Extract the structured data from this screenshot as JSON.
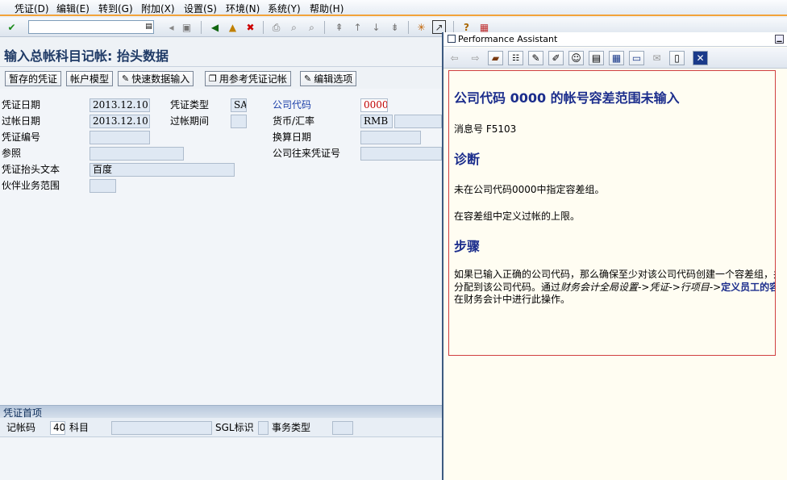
{
  "menu": {
    "items": [
      "凭证(D)",
      "编辑(E)",
      "转到(G)",
      "附加(X)",
      "设置(S)",
      "环境(N)",
      "系统(Y)",
      "帮助(H)"
    ]
  },
  "toolbar": {
    "command_value": "",
    "icons": [
      "ok-check-icon",
      "save-icon",
      "back-icon",
      "exit-icon",
      "cancel-icon",
      "print-icon",
      "find-icon",
      "find-next-icon",
      "first-page-icon",
      "prev-page-icon",
      "next-page-icon",
      "last-page-icon",
      "new-session-icon",
      "shortcut-icon",
      "help-icon",
      "layout-icon"
    ]
  },
  "page": {
    "title": "输入总帐科目记帐: 抬头数据"
  },
  "app_toolbar": {
    "buttons": [
      "暂存的凭证",
      "帐户模型",
      "快速数据输入",
      "用参考凭证记帐",
      "编辑选项"
    ]
  },
  "form": {
    "doc_date_label": "凭证日期",
    "doc_date_value": "2013.12.10",
    "doc_type_label": "凭证类型",
    "doc_type_value": "SA",
    "company_code_label": "公司代码",
    "company_code_value": "0000",
    "posting_date_label": "过帐日期",
    "posting_date_value": "2013.12.10",
    "period_label": "过帐期间",
    "period_value": "",
    "currency_label": "货币/汇率",
    "currency_value": "RMB",
    "rate_value": "",
    "doc_number_label": "凭证编号",
    "doc_number_value": "",
    "translation_date_label": "换算日期",
    "translation_date_value": "",
    "reference_label": "参照",
    "reference_value": "",
    "intercompany_label": "公司往来凭证号",
    "intercompany_value": "",
    "header_text_label": "凭证抬头文本",
    "header_text_value": "百度",
    "partner_ba_label": "伙伴业务范围",
    "partner_ba_value": ""
  },
  "tab": {
    "label": "凭证首项",
    "posting_key_label": "记帐码",
    "posting_key_value": "40",
    "account_label": "科目",
    "account_value": "",
    "sgl_label": "SGL标识",
    "sgl_value": "",
    "trans_type_label": "事务类型",
    "trans_type_value": ""
  },
  "assistant": {
    "window_title": "Performance Assistant",
    "heading": "公司代码 0000 的帐号容差范围未输入",
    "message_no": "消息号 F5103",
    "diagnosis_title": "诊断",
    "diagnosis_line1": "未在公司代码0000中指定容差组。",
    "diagnosis_line2": "在容差组中定义过帐的上限。",
    "procedure_title": "步骤",
    "procedure_line1": "如果已输入正确的公司代码，那么确保至少对该公司代码创建一个容差组，并且",
    "procedure_line2_a": "分配到该公司代码。通过",
    "procedure_line2_path": "财务会计全局设置->凭证->行项目->",
    "procedure_line2_link": "定义员工的容差组",
    "procedure_line3": "在财务会计中进行此操作。"
  }
}
